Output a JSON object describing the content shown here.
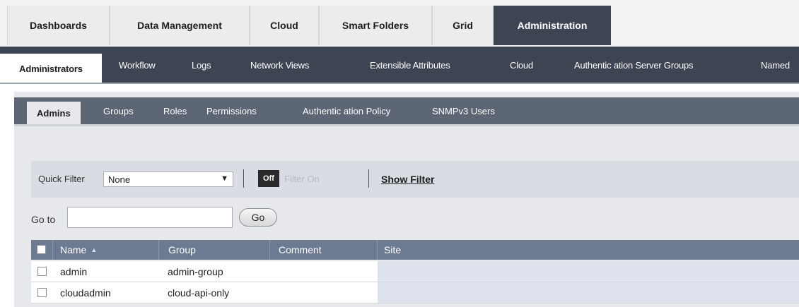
{
  "top_tabs": [
    {
      "label": "Dashboards"
    },
    {
      "label": "Data Management"
    },
    {
      "label": "Cloud"
    },
    {
      "label": "Smart Folders"
    },
    {
      "label": "Grid"
    },
    {
      "label": "Administration",
      "active": true
    }
  ],
  "nav_tabs": [
    {
      "label": "Administrators",
      "active": true
    },
    {
      "label": "Workflow"
    },
    {
      "label": "Logs"
    },
    {
      "label": "Network Views"
    },
    {
      "label": "Extensible Attributes"
    },
    {
      "label": "Cloud"
    },
    {
      "label": "Authentic ation Server Groups"
    },
    {
      "label": "Named"
    }
  ],
  "sub_tabs": [
    {
      "label": "Admins",
      "active": true
    },
    {
      "label": "Groups"
    },
    {
      "label": "Roles"
    },
    {
      "label": "Permissions"
    },
    {
      "label": "Authentic ation Policy"
    },
    {
      "label": "SNMPv3 Users"
    }
  ],
  "filter": {
    "label": "Quick Filter",
    "selected": "None",
    "toggle_off": "Off",
    "toggle_on": "Filter On",
    "show_filter": "Show Filter"
  },
  "goto": {
    "label": "Go to",
    "value": "",
    "button": "Go"
  },
  "table": {
    "columns": [
      "Name",
      "Group",
      "Comment",
      "Site"
    ],
    "sort_indicator": "▲",
    "rows": [
      {
        "name": "admin",
        "group": "admin-group",
        "comment": "",
        "site": ""
      },
      {
        "name": "cloudadmin",
        "group": "cloud-api-only",
        "comment": "",
        "site": ""
      }
    ]
  },
  "colors": {
    "nav_dark": "#3d4553",
    "sub_bar": "#5d6675",
    "table_header": "#6c7a92"
  }
}
